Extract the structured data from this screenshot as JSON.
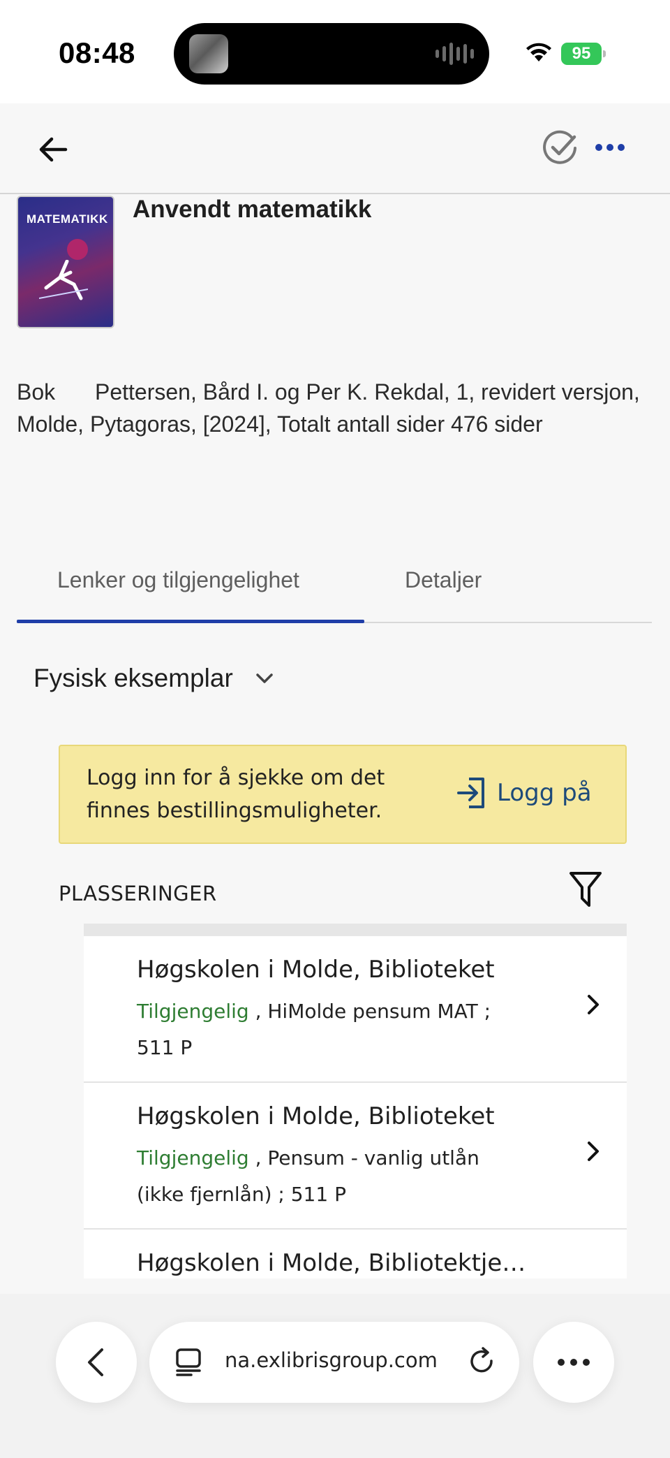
{
  "status_bar": {
    "time": "08:48",
    "battery": "95",
    "icons": [
      "wifi-icon",
      "battery-charging-icon"
    ]
  },
  "app_bar": {
    "icons": [
      "back-arrow-icon",
      "check-circle-icon",
      "more-horizontal-icon"
    ],
    "accent_color": "#1f3ea8"
  },
  "record": {
    "title": "Anvendt matematikk",
    "cover_text": "MATEMATIKK",
    "type": "Bok",
    "description": "Pettersen, Bård I. og Per K. Rekdal, 1, revidert versjon, Molde, Pytagoras, [2024], Totalt antall sider 476 sider"
  },
  "tabs": [
    {
      "label": "Lenker og tilgjengelighet",
      "active": true
    },
    {
      "label": "Detaljer",
      "active": false
    }
  ],
  "section": {
    "title": "Fysisk eksemplar"
  },
  "login_notice": {
    "text": "Logg inn for å sjekke om det finnes bestillingsmuligheter.",
    "button_label": "Logg på"
  },
  "locations": {
    "header": "PLASSERINGER",
    "items": [
      {
        "name": "Høgskolen i Molde, Biblioteket",
        "status": "Tilgjengelig",
        "details": ", HiMolde pensum MAT ; 511 P"
      },
      {
        "name": "Høgskolen i Molde, Biblioteket",
        "status": "Tilgjengelig",
        "details": ", Pensum - vanlig utlån (ikke fjernlån) ; 511 P"
      },
      {
        "name": "Høgskolen i Molde, Bibliotektje…",
        "status": "",
        "details": ""
      }
    ],
    "status_color": "#2e7d32"
  },
  "browser": {
    "url": "na.exlibrisgroup.com"
  }
}
